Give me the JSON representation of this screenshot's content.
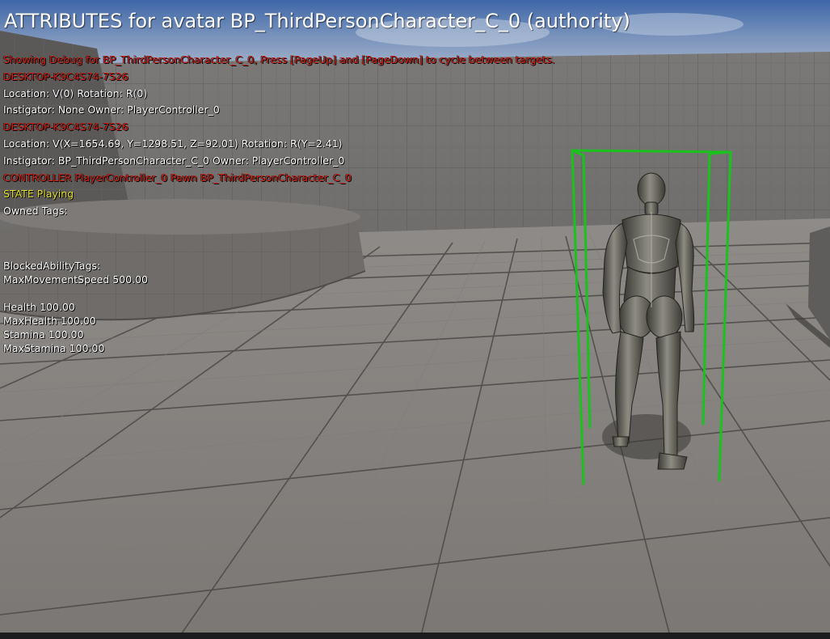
{
  "viewport": {
    "title": "ATTRIBUTES for avatar BP_ThirdPersonCharacter_C_0 (authority)"
  },
  "debug": {
    "lines": [
      {
        "text": "Showing Debug for BP_ThirdPersonCharacter_C_0, Press [PageUp] and [PageDown] to cycle between targets.",
        "color": "red"
      },
      {
        "text": "DESKTOP-K9C4S74-7526",
        "color": "red"
      },
      {
        "text": "Location: V(0) Rotation: R(0)",
        "color": "white"
      },
      {
        "text": " Instigator: None Owner: PlayerController_0",
        "color": "white"
      },
      {
        "text": "DESKTOP-K9C4S74-7526",
        "color": "red"
      },
      {
        "text": "Location: V(X=1654.69, Y=1298.51, Z=92.01) Rotation: R(Y=2.41)",
        "color": "white"
      },
      {
        "text": " Instigator: BP_ThirdPersonCharacter_C_0 Owner: PlayerController_0",
        "color": "white"
      },
      {
        "text": "CONTROLLER PlayerController_0 Pawn BP_ThirdPersonCharacter_C_0",
        "color": "red"
      },
      {
        "text": "STATE Playing",
        "color": "yellow"
      },
      {
        "text": "Owned Tags:",
        "color": "white"
      }
    ],
    "blocked_tags_label": "BlockedAbilityTags:",
    "max_movement_speed": "MaxMovementSpeed 500.00",
    "attributes": [
      "Health 100.00",
      "MaxHealth 100.00",
      "Stamina 100.00",
      "MaxStamina 100.00"
    ]
  },
  "colors": {
    "debug_red": "#d41c12",
    "debug_yellow": "#e8e42c",
    "debug_box_green": "#19c21c",
    "sky": "#5f7fae",
    "floor": "#8a8785"
  }
}
